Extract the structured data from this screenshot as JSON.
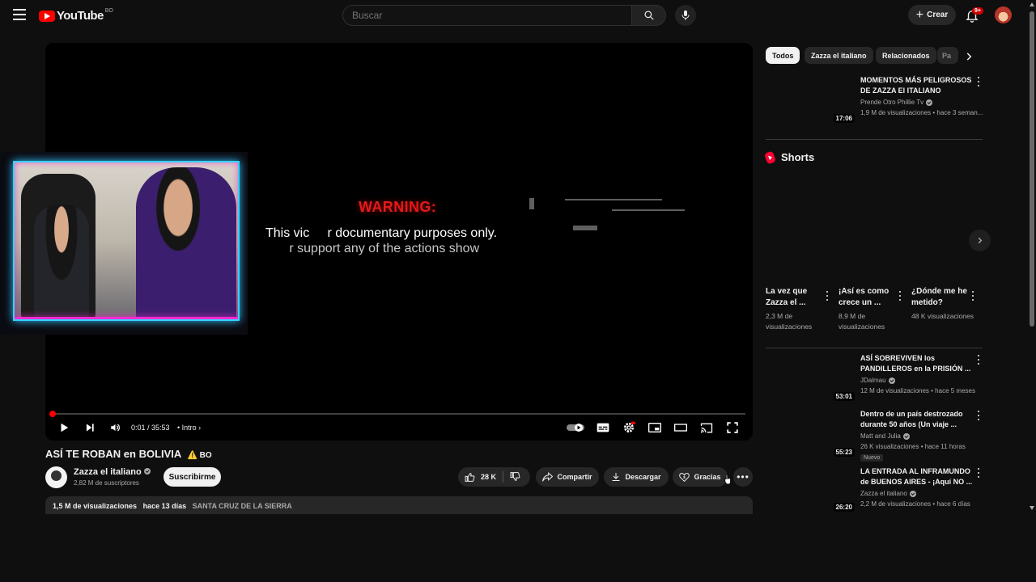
{
  "header": {
    "logo_text": "YouTube",
    "country_code": "BO",
    "search_placeholder": "Buscar",
    "create_label": "Crear",
    "notif_count": "9+"
  },
  "player": {
    "warning_title": "WARNING:",
    "warning_line1": "This vic     r documentary purposes only.",
    "warning_line2": "   r support any of the actions show",
    "time": "0:01 / 35:53",
    "chapter": "Intro",
    "progress_fraction": 0.0005
  },
  "video": {
    "title": "ASÍ TE ROBAN en BOLIVIA",
    "title_flag": "⚠️ BO",
    "channel_name": "Zazza el italiano",
    "subscribers": "2,82 M de suscriptores",
    "subscribe_label": "Suscribirme",
    "likes": "28 K",
    "share_label": "Compartir",
    "download_label": "Descargar",
    "thanks_label": "Gracias",
    "views": "1,5 M de visualizaciones",
    "date": "hace 13 días",
    "location": "SANTA CRUZ DE LA SIERRA"
  },
  "sidebar": {
    "chips": [
      "Todos",
      "Zazza el italiano",
      "Relacionados",
      "Pa"
    ],
    "recommended_top": {
      "title": "MOMENTOS MÁS PELIGROSOS DE ZAZZA El ITALIANO",
      "channel": "Prende Otro Phillie Tv",
      "meta": "1,9 M de visualizaciones • hace 3 seman...",
      "duration": "17:06"
    },
    "shorts_title": "Shorts",
    "shorts": [
      {
        "title": "La vez que Zazza el ...",
        "views": "2,3 M de visualizaciones"
      },
      {
        "title": "¡Así es como crece un ...",
        "views": "8,9 M de visualizaciones"
      },
      {
        "title": "¿Dónde me he metido?",
        "views": "48 K visualizaciones"
      }
    ],
    "recommended": [
      {
        "title": "ASÍ SOBREVIVEN los PANDILLEROS en la PRISIÓN ...",
        "channel": "JDalmau",
        "meta": "12 M de visualizaciones • hace 5 meses",
        "duration": "53:01",
        "badge": ""
      },
      {
        "title": "Dentro de un país destrozado durante 50 años (Un viaje ...",
        "channel": "Matt and Julia",
        "meta": "26 K visualizaciones • hace 11 horas",
        "duration": "55:23",
        "badge": "Nuevo"
      },
      {
        "title": "LA ENTRADA AL INFRAMUNDO de BUENOS AIRES - ¡Aquí NO ...",
        "channel": "Zazza el italiano",
        "meta": "2,2 M de visualizaciones • hace 6 días",
        "duration": "26:20",
        "badge": ""
      }
    ]
  },
  "colors": {
    "background": "#0f0f0f",
    "accent_red": "#ff0000",
    "warning_red": "#e21a1a",
    "webcam_cyan": "#34d3ff",
    "webcam_pink": "#ff2bd1"
  }
}
